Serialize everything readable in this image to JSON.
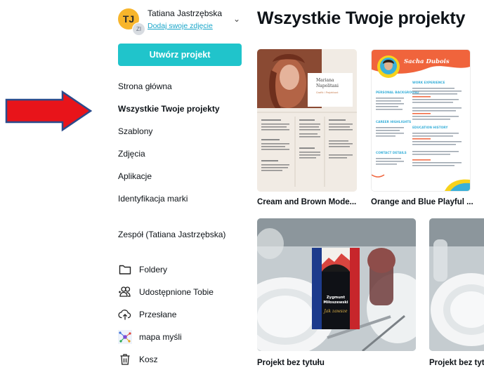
{
  "account": {
    "name": "Tatiana Jastrzębska",
    "initials": "TJ",
    "secondary_initials": "ZI",
    "add_photo_link": "Dodaj swoje zdjęcie"
  },
  "create_button_label": "Utwórz projekt",
  "nav": [
    {
      "label": "Strona główna",
      "active": false
    },
    {
      "label": "Wszystkie Twoje projekty",
      "active": true
    },
    {
      "label": "Szablony",
      "active": false
    },
    {
      "label": "Zdjęcia",
      "active": false
    },
    {
      "label": "Aplikacje",
      "active": false
    },
    {
      "label": "Identyfikacja marki",
      "active": false
    }
  ],
  "team_label": "Zespół (Tatiana Jastrzębska)",
  "tools": [
    {
      "label": "Foldery",
      "icon": "folder-icon"
    },
    {
      "label": "Udostępnione Tobie",
      "icon": "shared-users-icon"
    },
    {
      "label": "Przesłane",
      "icon": "cloud-upload-icon"
    },
    {
      "label": "mapa myśli",
      "icon": "mind-map-thumbnail"
    },
    {
      "label": "Kosz",
      "icon": "trash-icon"
    }
  ],
  "page_title": "Wszystkie Twoje projekty",
  "designs": [
    {
      "title": "Cream and Brown Mode...",
      "thumb_name": "Mariana Napolitani",
      "thumb_sub": "Grafik i Projektant"
    },
    {
      "title": "Orange and Blue Playful ...",
      "thumb_name": "Sacha Dubois",
      "sections": [
        "PERSONAL BACKGROUND",
        "CAREER HIGHLIGHTS",
        "CONTACT DETAILS"
      ],
      "right_sections": [
        "WORK EXPERIENCE",
        "EDUCATION HISTORY"
      ]
    },
    {
      "title": "Projekt bez tytułu",
      "book_author": "Zygmunt Miłoszewski",
      "book_title": "Jak zawsze"
    },
    {
      "title": "Projekt bez tyt"
    }
  ],
  "colors": {
    "accent_button": "#20c4cb",
    "link": "#18a5c9",
    "arrow_fill": "#e8141a",
    "arrow_stroke": "#2b4b8c",
    "avatar": "#f7b52c",
    "cv_orange": "#f0643c"
  }
}
